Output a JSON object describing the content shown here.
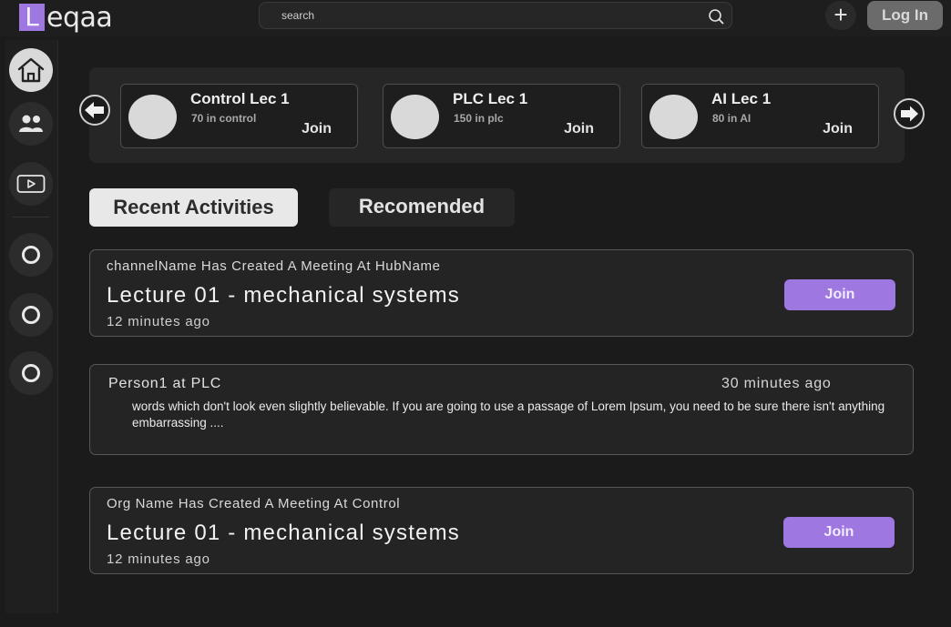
{
  "app": {
    "logo_letter": "L",
    "logo_text": "eqaa",
    "accent": "#9f77e0"
  },
  "header": {
    "search_placeholder": "search",
    "login_label": "Log In",
    "add_label": "+"
  },
  "sidebar": {
    "items": [
      {
        "icon": "home-icon"
      },
      {
        "icon": "users-icon"
      },
      {
        "icon": "video-icon"
      },
      {
        "icon": "circle-icon"
      },
      {
        "icon": "circle-icon"
      },
      {
        "icon": "circle-icon"
      }
    ]
  },
  "lectures": [
    {
      "title": "Control Lec 1",
      "subtitle": "70 in control",
      "action": "Join"
    },
    {
      "title": "PLC Lec 1",
      "subtitle": "150 in plc",
      "action": "Join"
    },
    {
      "title": "AI Lec 1",
      "subtitle": "80 in AI",
      "action": "Join"
    }
  ],
  "tabs": [
    {
      "label": "Recent Activities",
      "active": true
    },
    {
      "label": "Recomended",
      "active": false
    }
  ],
  "activities": [
    {
      "meta": "channelName Has Created A Meeting At HubName",
      "title": "Lecture 01 - mechanical systems",
      "time": "12 minutes ago",
      "action": "Join"
    },
    {
      "author": "Person1 at  PLC",
      "time": "30 minutes ago",
      "body": "words which don't look even slightly believable. If you are going to use a passage of Lorem Ipsum, you need to be sure there isn't anything embarrassing ...."
    },
    {
      "meta": "Org Name Has Created A Meeting At Control",
      "title": "Lecture 01 - mechanical systems",
      "time": "12 minutes ago",
      "action": "Join"
    }
  ]
}
